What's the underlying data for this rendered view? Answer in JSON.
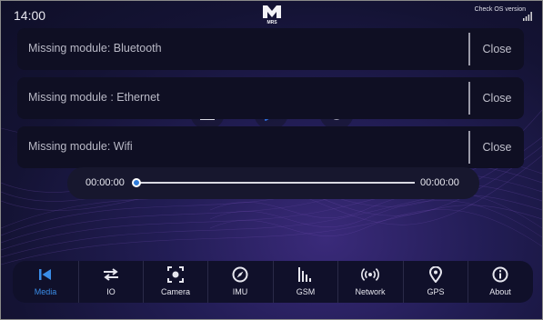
{
  "status_bar": {
    "time": "14:00",
    "logo_text": "MRS",
    "check_os_label": "Check OS version"
  },
  "notifications": [
    {
      "message": "Missing module: Bluetooth",
      "close_label": "Close"
    },
    {
      "message": "Missing module : Ethernet",
      "close_label": "Close"
    },
    {
      "message": "Missing module: Wifi",
      "close_label": "Close"
    }
  ],
  "media_controls": {
    "icons": [
      "stop-icon",
      "play-icon",
      "replay-icon"
    ],
    "play_color": "#2d6bd3"
  },
  "progress": {
    "current_time": "00:00:00",
    "total_time": "00:00:00",
    "position_fraction": 0
  },
  "nav": {
    "items": [
      {
        "label": "Media",
        "icon": "skip-back-icon",
        "active": true
      },
      {
        "label": "IO",
        "icon": "swap-arrows-icon",
        "active": false
      },
      {
        "label": "Camera",
        "icon": "camera-focus-icon",
        "active": false
      },
      {
        "label": "IMU",
        "icon": "compass-icon",
        "active": false
      },
      {
        "label": "GSM",
        "icon": "signal-bars-icon",
        "active": false
      },
      {
        "label": "Network",
        "icon": "wireless-icon",
        "active": false
      },
      {
        "label": "GPS",
        "icon": "location-pin-icon",
        "active": false
      },
      {
        "label": "About",
        "icon": "info-icon",
        "active": false
      }
    ],
    "active_color": "#3a8de8"
  }
}
